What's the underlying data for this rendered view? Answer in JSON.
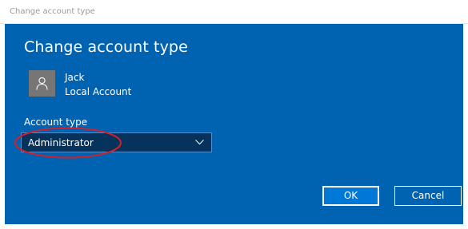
{
  "window": {
    "title": "Change account type"
  },
  "dialog": {
    "heading": "Change account type",
    "user": {
      "name": "Jack",
      "account_kind": "Local Account",
      "avatar_icon": "user-icon"
    },
    "account_type": {
      "label": "Account type",
      "selected": "Administrator"
    },
    "buttons": {
      "ok": "OK",
      "cancel": "Cancel"
    }
  },
  "colors": {
    "dialog_background": "#0063b1",
    "select_background": "#06335c",
    "highlight": "#d0202a"
  }
}
